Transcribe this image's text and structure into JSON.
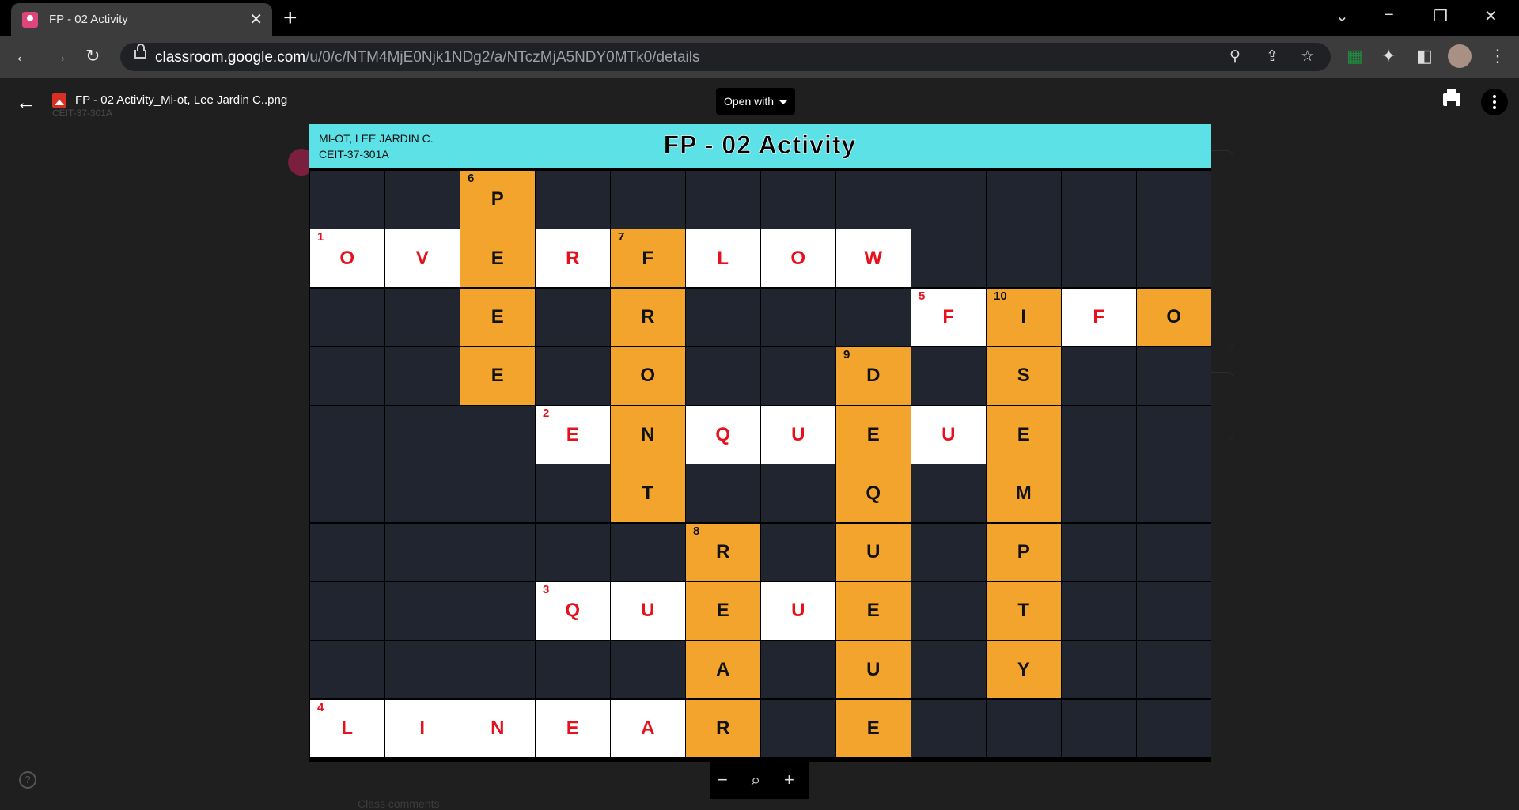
{
  "browser": {
    "tab_title": "FP - 02 Activity",
    "tab_close": "✕",
    "new_tab": "+",
    "url_host": "classroom.google.com",
    "url_path": "/u/0/c/NTM4MjE0Njk1NDg2/a/NTczMjA5NDY0MTk0/details"
  },
  "viewer": {
    "file_name": "FP - 02 Activity_Mi-ot, Lee Jardin C..png",
    "ghost_subtitle": "CEIT-37-301A",
    "open_with_label": "Open with",
    "class_comments": "Class comments"
  },
  "crossword": {
    "student_name": "MI-OT, LEE JARDIN C.",
    "student_section": "CEIT-37-301A",
    "title": "FP - 02 Activity",
    "rows": [
      [
        "",
        "",
        "P",
        "",
        "",
        "",
        "",
        "",
        "",
        "",
        "",
        ""
      ],
      [
        "O",
        "V",
        "E",
        "R",
        "F",
        "L",
        "O",
        "W",
        "",
        "",
        "",
        ""
      ],
      [
        "",
        "",
        "E",
        "",
        "R",
        "",
        "",
        "",
        "F",
        "I",
        "F",
        "O"
      ],
      [
        "",
        "",
        "E",
        "",
        "O",
        "",
        "",
        "D",
        "",
        "S",
        "",
        ""
      ],
      [
        "",
        "",
        "",
        "E",
        "N",
        "Q",
        "U",
        "E",
        "U",
        "E",
        "",
        ""
      ],
      [
        "",
        "",
        "",
        "",
        "T",
        "",
        "",
        "Q",
        "",
        "M",
        "",
        ""
      ],
      [
        "",
        "",
        "",
        "",
        "",
        "R",
        "",
        "U",
        "",
        "P",
        "",
        ""
      ],
      [
        "",
        "",
        "",
        "Q",
        "U",
        "E",
        "U",
        "E",
        "",
        "T",
        "",
        ""
      ],
      [
        "",
        "",
        "",
        "",
        "",
        "A",
        "",
        "U",
        "",
        "Y",
        "",
        ""
      ],
      [
        "L",
        "I",
        "N",
        "E",
        "A",
        "R",
        "",
        "E",
        "",
        "",
        "",
        ""
      ]
    ],
    "fills": [
      "..o.........",
      "wwowowww....",
      "..o.o...wowo",
      "..o.o..o.o..",
      "...wowwowo..",
      "....o..o.o..",
      ".....o.o.o..",
      "...wwowo.o..",
      ".....o.o.o..",
      "wwwwwo.o...."
    ],
    "clue_numbers": [
      {
        "row": 0,
        "col": 2,
        "n": "6",
        "color": "black"
      },
      {
        "row": 1,
        "col": 0,
        "n": "1",
        "color": "red"
      },
      {
        "row": 1,
        "col": 4,
        "n": "7",
        "color": "black"
      },
      {
        "row": 2,
        "col": 8,
        "n": "5",
        "color": "red"
      },
      {
        "row": 2,
        "col": 9,
        "n": "10",
        "color": "black"
      },
      {
        "row": 3,
        "col": 7,
        "n": "9",
        "color": "black"
      },
      {
        "row": 4,
        "col": 3,
        "n": "2",
        "color": "red"
      },
      {
        "row": 6,
        "col": 5,
        "n": "8",
        "color": "black"
      },
      {
        "row": 7,
        "col": 3,
        "n": "3",
        "color": "red"
      },
      {
        "row": 9,
        "col": 0,
        "n": "4",
        "color": "red"
      }
    ],
    "colors": {
      "header": "#5ce1e6",
      "dark_cell": "#202530",
      "white_cell": "#ffffff",
      "orange_cell": "#f2a42c",
      "letter_red": "#e6111d",
      "letter_black": "#111111"
    }
  },
  "icons": {
    "back": "←",
    "forward": "→",
    "reload": "↻",
    "zoom_out": "−",
    "zoom_search": "⌕",
    "zoom_in": "+",
    "help": "?"
  }
}
